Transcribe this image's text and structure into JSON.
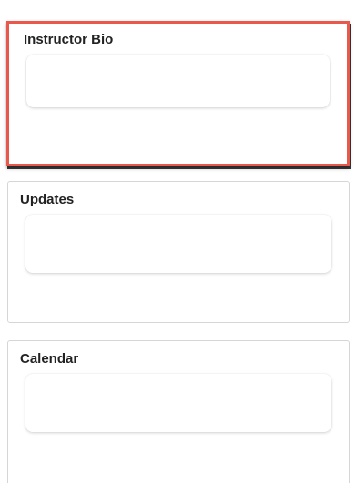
{
  "cards": [
    {
      "title": "Instructor Bio",
      "highlighted": true
    },
    {
      "title": "Updates",
      "highlighted": false
    },
    {
      "title": "Calendar",
      "highlighted": false
    }
  ],
  "colors": {
    "highlight_border": "#e8584c",
    "card_border": "#d6d6d6",
    "title_text": "#222222"
  }
}
